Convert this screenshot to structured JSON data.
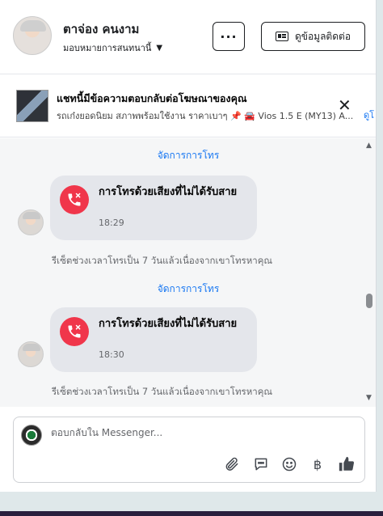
{
  "header": {
    "contact_name": "ตาจ่อง คนงาม",
    "assign_label": "มอบหมายการสนทนานี้",
    "more_label": "···",
    "contact_info_label": "ดูข้อมูลติดต่อ"
  },
  "ad_banner": {
    "title": "แชทนี้มีข้อความตอบกลับต่อโฆษณาของคุณ",
    "subtitle": "รถเก๋งยอดนิยม สภาพพร้อมใช้งาน ราคาเบาๆ 📌 🚘 Vios 1.5 E (MY13) A...",
    "link_label": "ดูโ",
    "close_label": "✕"
  },
  "thread": {
    "items": [
      {
        "manage_label": "จัดการการโทร",
        "call_title": "การโทรด้วยเสียงที่ไม่ได้รับสาย",
        "call_time": "18:29",
        "reset_note": "รีเซ็ตช่วงเวลาโทรเป็น 7 วันแล้วเนื่องจากเขาโทรหาคุณ"
      },
      {
        "manage_label": "จัดการการโทร",
        "call_title": "การโทรด้วยเสียงที่ไม่ได้รับสาย",
        "call_time": "18:30",
        "reset_note": "รีเซ็ตช่วงเวลาโทรเป็น 7 วันแล้วเนื่องจากเขาโทรหาคุณ"
      }
    ]
  },
  "composer": {
    "placeholder": "ตอบกลับใน Messenger...",
    "currency_symbol": "฿"
  },
  "colors": {
    "accent": "#1877f2",
    "missed_call": "#f0364b",
    "bubble": "#e4e6eb"
  }
}
